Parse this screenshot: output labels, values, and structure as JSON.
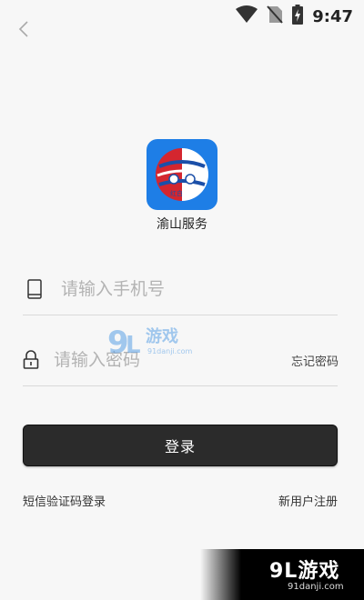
{
  "status_bar": {
    "time": "9:47",
    "icons": [
      "wifi-icon",
      "no-sim-icon",
      "battery-charging-icon"
    ]
  },
  "nav": {
    "back_icon": "chevron-left-icon"
  },
  "app": {
    "name": "渝山服务",
    "logo_text": "红白",
    "colors": {
      "tile": "#1e7ee6",
      "red": "#d4262f",
      "blue": "#1b4fa8"
    }
  },
  "form": {
    "phone": {
      "placeholder": "请输入手机号",
      "value": "",
      "icon": "phone-icon"
    },
    "password": {
      "placeholder": "请输入密码",
      "value": "",
      "icon": "lock-icon"
    },
    "forgot_label": "忘记密码"
  },
  "login_button": {
    "label": "登录"
  },
  "links": {
    "sms_login": "短信验证码登录",
    "register": "新用户注册"
  },
  "watermark": {
    "brand": "9L游戏",
    "url": "91danji.com",
    "mid_text": "游戏",
    "mid_url": "91danji.com"
  },
  "colors": {
    "background": "#f7f7f7",
    "button": "#2b2b2b"
  }
}
